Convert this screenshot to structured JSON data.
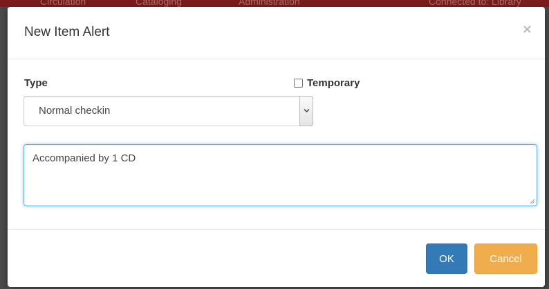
{
  "background_nav": {
    "items": [
      "Circulation",
      "Cataloging",
      "Administration",
      "Connected to: Library"
    ]
  },
  "modal": {
    "title": "New Item Alert",
    "close_label": "×",
    "type_label": "Type",
    "temporary_label": "Temporary",
    "temporary_checked": false,
    "type_select": {
      "selected": "Normal checkin"
    },
    "note_text": "Accompanied by 1 CD",
    "ok_label": "OK",
    "cancel_label": "Cancel"
  },
  "colors": {
    "primary": "#337ab7",
    "warning": "#f0ad4e",
    "header_bar": "#7a1c1c",
    "focus_border": "#66afe9"
  }
}
